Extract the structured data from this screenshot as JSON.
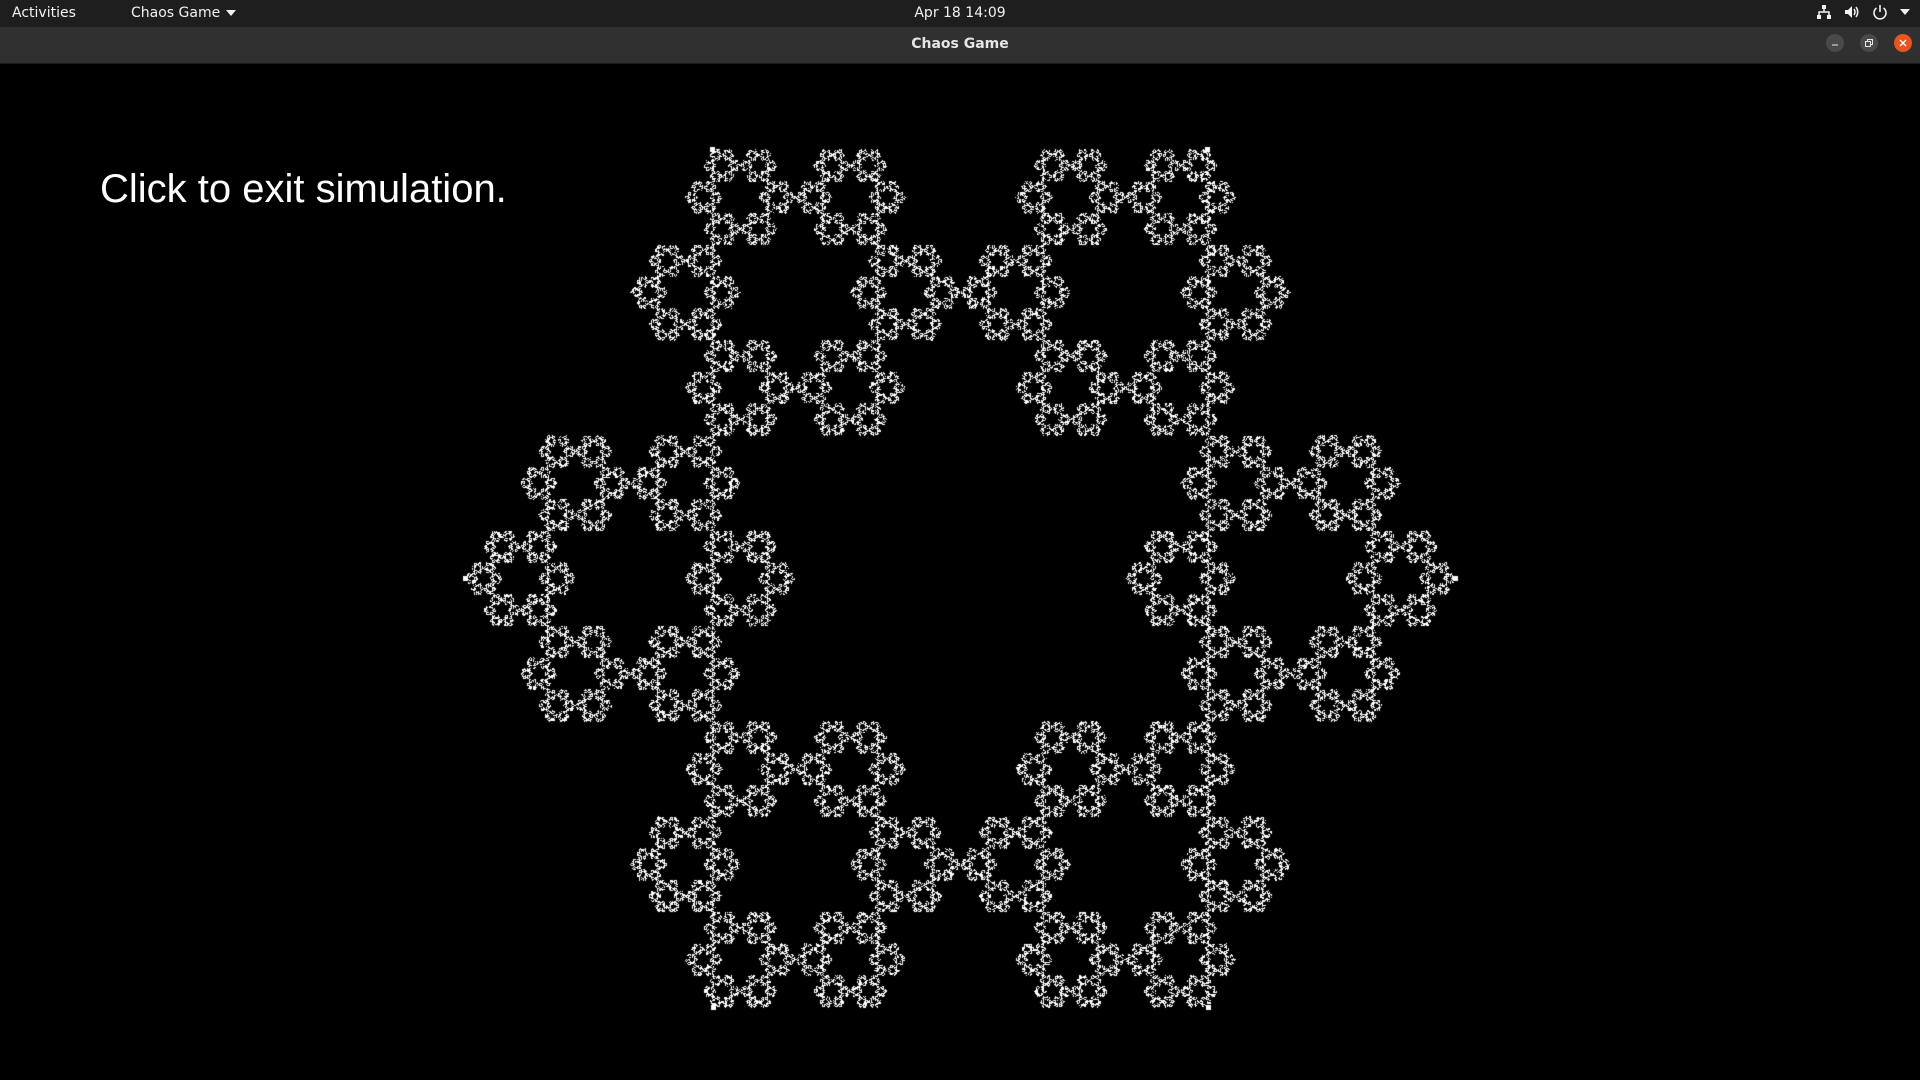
{
  "topbar": {
    "activities_label": "Activities",
    "app_menu_label": "Chaos Game",
    "clock": "Apr 18  14:09",
    "tray_icons": [
      "network-icon",
      "volume-icon",
      "power-icon",
      "system-menu-chevron-icon"
    ]
  },
  "window": {
    "title": "Chaos Game",
    "controls": [
      "minimize",
      "restore",
      "close"
    ],
    "close_color": "#e95420"
  },
  "simulation": {
    "instruction": "Click to exit simulation.",
    "attractor_vertices": 6,
    "jump_ratio": 0.333,
    "point_color": "#ffffff",
    "background_color": "#000000"
  }
}
